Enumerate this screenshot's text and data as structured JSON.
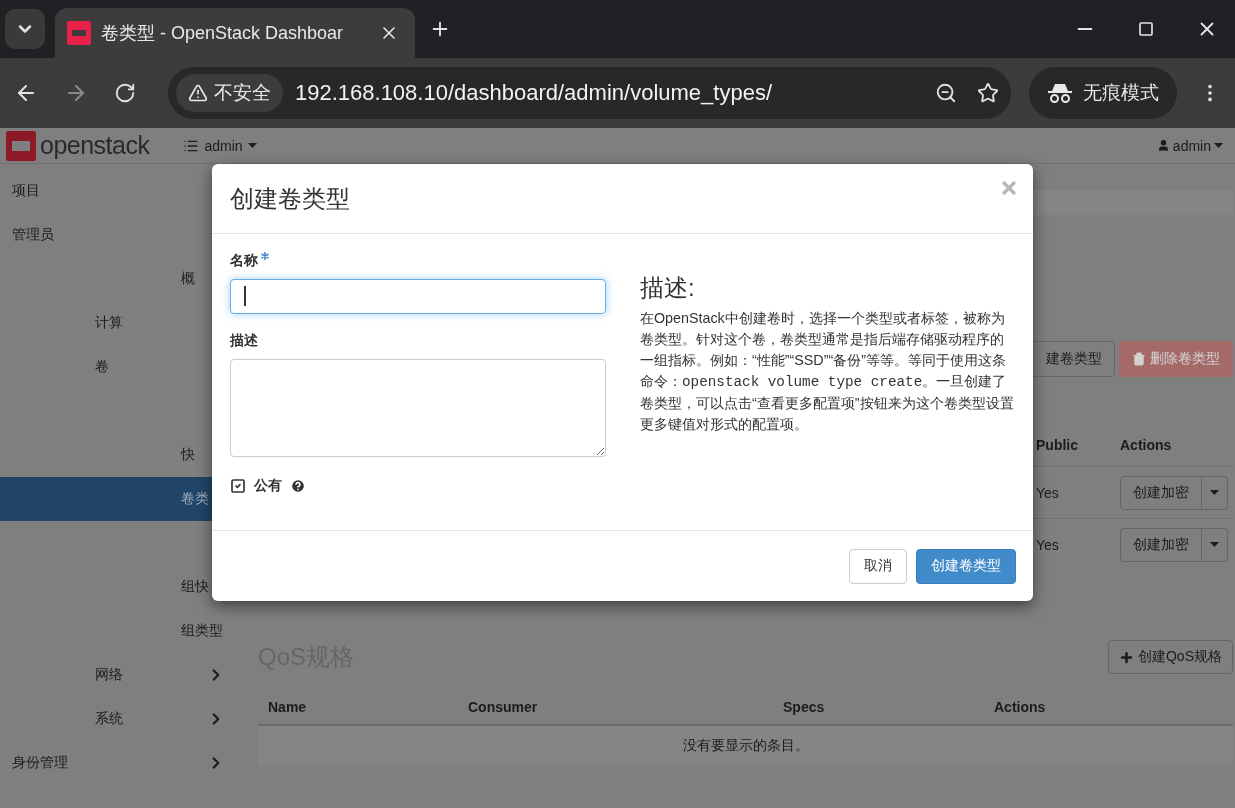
{
  "browser": {
    "tab": {
      "title": "卷类型 - OpenStack Dashboar"
    },
    "address": {
      "security": "不安全",
      "url": "192.168.108.10/dashboard/admin/volume_types/"
    },
    "profile": "无痕模式"
  },
  "header": {
    "logo": "openstack",
    "project": "admin",
    "user": "admin"
  },
  "sidebar": {
    "items": [
      {
        "kind": "dashboard",
        "label": "项目",
        "selected": false
      },
      {
        "kind": "dashboard",
        "label": "管理员",
        "selected": false,
        "children": [
          {
            "kind": "panel",
            "label": "概",
            "selected": false
          },
          {
            "kind": "group",
            "label": "计算",
            "selected": false
          },
          {
            "kind": "group",
            "label": "卷",
            "selected": false,
            "children": [
              {
                "kind": "covered"
              },
              {
                "kind": "panel",
                "label": "快",
                "selected": false
              },
              {
                "kind": "panel",
                "label": "卷类",
                "selected": true
              },
              {
                "kind": "covered"
              },
              {
                "kind": "panel",
                "label": "组快",
                "selected": false
              },
              {
                "kind": "panel",
                "label": "组类型",
                "selected": false
              }
            ]
          },
          {
            "kind": "group",
            "label": "网络",
            "selected": false,
            "expanded": false
          },
          {
            "kind": "group",
            "label": "系统",
            "selected": false,
            "expanded": false
          }
        ]
      },
      {
        "kind": "dashboard",
        "label": "身份管理",
        "selected": false,
        "expanded": false
      }
    ]
  },
  "content": {
    "volume_types": {
      "actions": [
        {
          "kind": "create",
          "label": "建卷类型",
          "disabled": false
        },
        {
          "kind": "delete",
          "label": "删除卷类型",
          "disabled": true
        }
      ],
      "columns": [
        "Public",
        "Actions"
      ],
      "rows": [
        {
          "public": "Yes",
          "action": "创建加密"
        },
        {
          "public": "Yes",
          "action": "创建加密"
        }
      ]
    },
    "qos": {
      "title": "QoS规格",
      "create": "创建QoS规格",
      "columns": [
        "Name",
        "Consumer",
        "Specs",
        "Actions"
      ],
      "empty": "没有要显示的条目。"
    }
  },
  "modal": {
    "title": "创建卷类型",
    "fields": [
      {
        "kind": "input",
        "label": "名称",
        "required": true,
        "focused": true
      },
      {
        "kind": "textarea",
        "label": "描述",
        "required": false,
        "focused": false
      }
    ],
    "public": {
      "label": "公有",
      "checked": true
    },
    "help": {
      "title": "描述:",
      "parts": [
        {
          "kind": "text",
          "text": "在OpenStack中创建卷时，选择一个类型或者标签，被称为卷类型。针对这个卷，卷类型通常是指后端存储驱动程序的一组指标。例如：“性能”“SSD”“备份”等等。等同于使用这条命令："
        },
        {
          "kind": "code",
          "text": "openstack volume type create"
        },
        {
          "kind": "text",
          "text": "。一旦创建了卷类型，可以点击“查看更多配置项”按钮来为这个卷类型设置更多键值对形式的配置项。"
        }
      ]
    },
    "buttons": [
      {
        "kind": "cancel",
        "label": "取消"
      },
      {
        "kind": "primary",
        "label": "创建卷类型"
      }
    ]
  }
}
